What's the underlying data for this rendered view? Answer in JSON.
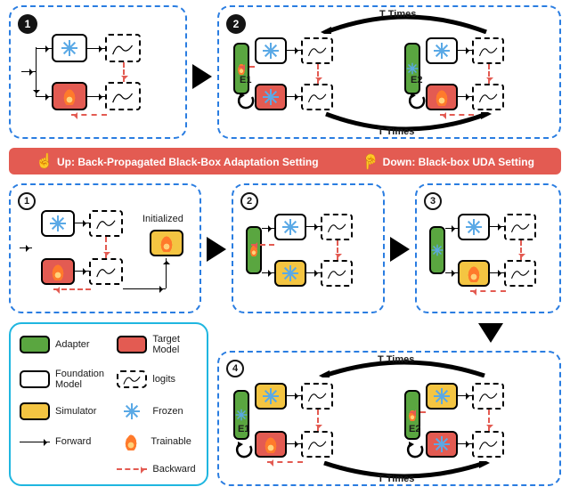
{
  "banner": {
    "up_label": "Up: Back-Propagated Black-Box Adaptation Setting",
    "down_label": "Down: Black-box UDA Setting"
  },
  "top": {
    "step1_badge": "1",
    "step2_badge": "2",
    "t_times_top": "T Times",
    "t_times_bottom": "T Times",
    "e1": "E1",
    "e2": "E2"
  },
  "bottom": {
    "step1": "1",
    "step2": "2",
    "step3": "3",
    "step4": "4",
    "initialized": "Initialized",
    "t_times_top": "T Times",
    "t_times_bottom": "T Times",
    "e1": "E1",
    "e2": "E2"
  },
  "legend": {
    "adapter": "Adapter",
    "target": "Target\nModel",
    "foundation": "Foundation\nModel",
    "logits": "logits",
    "simulator": "Simulator",
    "frozen": "Frozen",
    "forward": "Forward",
    "trainable": "Trainable",
    "backward": "Backward"
  },
  "icons": {
    "snowflake": "frozen-icon",
    "flame": "trainable-icon",
    "hand_up": "☝",
    "hand_down": "👇"
  },
  "chart_data": {
    "type": "diagram",
    "note": "Two training-pipeline schematics (no quantitative axes).",
    "rows": [
      {
        "name": "Back-Propagated Black-Box Adaptation",
        "steps": [
          {
            "id": 1,
            "branches": [
              {
                "block": "Foundation Model",
                "state": "frozen",
                "outputs": "logits"
              },
              {
                "block": "Target Model",
                "state": "trainable",
                "outputs": "logits"
              }
            ],
            "backward": "logits→Target Model"
          },
          {
            "id": 2,
            "loops": "T Times",
            "phases": [
              {
                "label": "E1",
                "adapter": "trainable",
                "foundation": "frozen",
                "target": "frozen"
              },
              {
                "label": "E2",
                "adapter": "frozen",
                "foundation": "frozen",
                "target": "trainable"
              }
            ]
          }
        ]
      },
      {
        "name": "Black-box UDA",
        "steps": [
          {
            "id": 1,
            "foundation": "frozen",
            "target": "trainable",
            "simulator_init_from": "Target Model",
            "simulator": "trainable"
          },
          {
            "id": 2,
            "adapter": "trainable",
            "foundation": "frozen",
            "simulator": "frozen"
          },
          {
            "id": 3,
            "adapter": "frozen",
            "foundation": "frozen",
            "simulator": "trainable"
          },
          {
            "id": 4,
            "loops": "T Times",
            "phases": [
              {
                "label": "E1",
                "adapter": "frozen",
                "simulator": "frozen",
                "target": "trainable"
              },
              {
                "label": "E2",
                "adapter": "trainable",
                "simulator": "frozen",
                "target": "frozen"
              }
            ]
          }
        ]
      }
    ]
  }
}
